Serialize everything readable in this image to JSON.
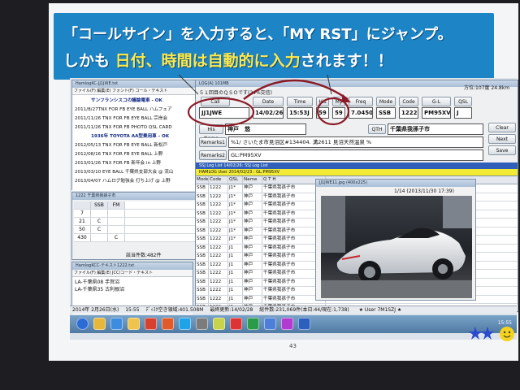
{
  "slide": {
    "headline_1": "「コールサイン」を入力すると、「MY RST」にジャンプ。",
    "headline_2_prefix": "しかも",
    "headline_2_hl": "日付、時間は自動的に入力",
    "headline_2_suffix": "されます！！",
    "page_number": "43",
    "colors": {
      "banner": "#1d84c6",
      "highlight": "#ffe94a",
      "annotation": "#8c1a26"
    }
  },
  "log_window": {
    "title": "LOG(A)  101MB",
    "subtitle": "５１回目のＱＳＯです(24%交信)",
    "rate": "方位:107度 24.8km",
    "headers": {
      "call": "Call",
      "date": "Date",
      "time": "Time",
      "his": "His",
      "my": "My",
      "freq": "Freq",
      "mode": "Mode",
      "code": "Code",
      "gl": "G-L",
      "qsl": "QSL"
    },
    "values": {
      "call": "JJ1JWE",
      "date": "14/02/26",
      "time": "15:53J",
      "his": "59",
      "my": "59",
      "freq": "7.0450",
      "mode": "SSB",
      "code": "1222",
      "gl": "PM95XV",
      "qsl": "J"
    },
    "his_name_label": "His Name",
    "his_name": "神戸　悠",
    "qth_label": "QTH",
    "qth": "千葉県我孫子市",
    "remarks1_label": "Remarks1",
    "remarks1": "%1/ さいたま市見沼区#134404. 溝2611 見沼天然温泉 %",
    "remarks2_label": "Remarks2",
    "remarks2": "GL:PM95XV",
    "side_buttons": [
      "Clear",
      "Next",
      "Save"
    ],
    "log_list_title": "SSJ Log List 14/02/26: SSJ Log List",
    "log_list_user": "HAMLOG User 2014/02/23 : GL:PM95XV",
    "grid_headers": [
      "Mode",
      "Code",
      "QSL",
      "Name",
      "Q T H"
    ],
    "grid_rows": [
      {
        "mode": "SSB",
        "code": "1222",
        "qsl": "J1*",
        "name": "神戸",
        "qth": "千葉県我孫子市"
      },
      {
        "mode": "SSB",
        "code": "1222",
        "qsl": "J1*",
        "name": "神戸",
        "qth": "千葉県我孫子市"
      },
      {
        "mode": "SSB",
        "code": "1222",
        "qsl": "J1*",
        "name": "神戸",
        "qth": "千葉県我孫子市"
      },
      {
        "mode": "SSB",
        "code": "1222",
        "qsl": "J1*",
        "name": "神戸",
        "qth": "千葉県我孫子市"
      },
      {
        "mode": "SSB",
        "code": "1222",
        "qsl": "J1*",
        "name": "神戸",
        "qth": "千葉県我孫子市"
      },
      {
        "mode": "SSB",
        "code": "1222",
        "qsl": "J1*",
        "name": "神戸",
        "qth": "千葉県我孫子市"
      },
      {
        "mode": "SSB",
        "code": "1222",
        "qsl": "J1*",
        "name": "神戸",
        "qth": "千葉県我孫子市"
      },
      {
        "mode": "SSB",
        "code": "1222",
        "qsl": "J1",
        "name": "神戸",
        "qth": "千葉県我孫子市"
      },
      {
        "mode": "SSB",
        "code": "1222",
        "qsl": "J1",
        "name": "神戸",
        "qth": "千葉県我孫子市"
      },
      {
        "mode": "SSB",
        "code": "1222",
        "qsl": "J1",
        "name": "神戸",
        "qth": "千葉県我孫子市"
      },
      {
        "mode": "SSB",
        "code": "1222",
        "qsl": "J1",
        "name": "神戸",
        "qth": "千葉県我孫子市"
      },
      {
        "mode": "SSB",
        "code": "1222",
        "qsl": "J1",
        "name": "神戸",
        "qth": "千葉県我孫子市"
      },
      {
        "mode": "SSB",
        "code": "1222",
        "qsl": "J1",
        "name": "神戸",
        "qth": "千葉県我孫子市"
      },
      {
        "mode": "SSB",
        "code": "1222",
        "qsl": "J1",
        "name": "神戸",
        "qth": "千葉県我孫子市"
      },
      {
        "mode": "SSB",
        "code": "1222",
        "qsl": "J1",
        "name": "神戸",
        "qth": "千葉県我孫子市"
      }
    ]
  },
  "notes_window": {
    "title": "HamlogKC-JJ1JWE.txt",
    "menu": "ファイル(F)  編集(E)  フォント(F)  コール・テキスト",
    "lines": [
      "サンフランシスコの議論電車 - OK",
      "2011/8/27TNX FOR FB EYE BALL ハムフェア",
      "2011/11/26 TNX FOR FB EYE BALL 宗岸会",
      "2011/11/26 TNX FOR FB PHOTO QSL CARD",
      "1936年 TOYOTA AA型乗用車 - OK",
      "2012/05/13 TNX FOR FB EYE BALL 新松戸",
      "2012/08/16 TNX FOR FB EYE BALL 上野",
      "2013/01/26 TNX FOR FB 新年会 in 上野",
      "2013/03/10 EYE BALL 千葉県支部大会 @ 流山",
      "2013/04/07 ハムログ勉強会 打ち上げ @ 上野"
    ]
  },
  "code_window": {
    "title": "1222 千葉県我孫子市",
    "headers": [
      "",
      "SSB",
      "FM"
    ],
    "rows": [
      [
        "7",
        "",
        ""
      ],
      [
        "21",
        "C",
        ""
      ],
      [
        "50",
        "C",
        ""
      ],
      [
        "430",
        "",
        "C"
      ]
    ],
    "footer": "該当件数:482件"
  },
  "text_window": {
    "title": "HamlogKCC-テキスト1222.txt",
    "menu": "ファイル(F)  編集(E)  JCC/コード・テキスト",
    "lines": [
      "LA-千葉県08 手賀沼",
      "LA-千葉県35 古利根沼"
    ]
  },
  "photo_window": {
    "title": "JJ1JWE11.jpg (400x225)",
    "caption": "1/14 (2013/11/30  17:39)"
  },
  "status_bar": {
    "date": "2014年 2月26日(水)",
    "time": "15:55",
    "disk": "ﾃﾞｨｽｸ空き領域:401.508M",
    "last_update": "最終更新:14/02/28",
    "total": "総件数:231,069件(本日:44/現在:1,738)",
    "user": "★ User 7M1SZJ ★"
  },
  "taskbar": {
    "clock": "15:55",
    "icons": [
      "start-orb",
      "folder-icon",
      "ie-icon",
      "explorer-icon",
      "chrome-icon",
      "media-icon",
      "skype-icon",
      "app-icon",
      "hamlog-icon",
      "app2-icon",
      "app3-icon",
      "app4-icon",
      "app5-icon",
      "word-icon"
    ]
  }
}
